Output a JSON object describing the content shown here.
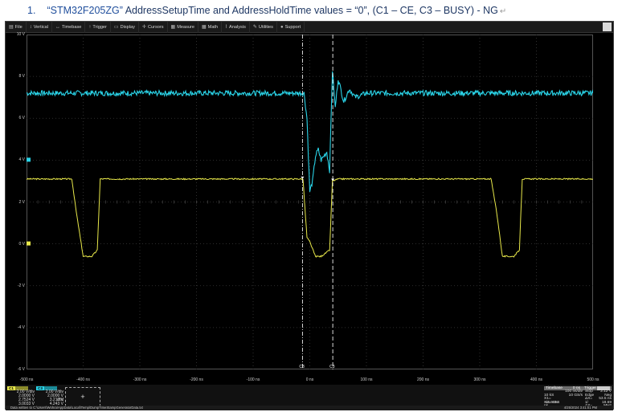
{
  "doc": {
    "number": "1.",
    "model": "“STM32F205ZG”",
    "rest": " AddressSetupTime and AddressHoldTime values = “0”, (C1 – CE, C3 – BUSY) - NG",
    "return_mark": "↵"
  },
  "menu": [
    {
      "icon": "▤",
      "label": "File",
      "name": "menu-file"
    },
    {
      "icon": "↕",
      "label": "Vertical",
      "name": "menu-vertical"
    },
    {
      "icon": "↔",
      "label": "Timebase",
      "name": "menu-timebase"
    },
    {
      "icon": "↑",
      "label": "Trigger",
      "name": "menu-trigger"
    },
    {
      "icon": "▭",
      "label": "Display",
      "name": "menu-display"
    },
    {
      "icon": "✛",
      "label": "Cursors",
      "name": "menu-cursors"
    },
    {
      "icon": "▦",
      "label": "Measure",
      "name": "menu-measure"
    },
    {
      "icon": "▦",
      "label": "Math",
      "name": "menu-math"
    },
    {
      "icon": "⌇",
      "label": "Analysis",
      "name": "menu-analysis"
    },
    {
      "icon": "✎",
      "label": "Utilities",
      "name": "menu-utilities"
    },
    {
      "icon": "●",
      "label": "Support",
      "name": "menu-support"
    }
  ],
  "brand_badge": "Teledyne LeCroy",
  "y_labels": [
    "10 V",
    "8 V",
    "6 V",
    "4 V",
    "2 V",
    "0 V",
    "-2 V",
    "-4 V",
    "-6 V"
  ],
  "x_labels": [
    "-500 ns",
    "-400 ns",
    "-300 ns",
    "-200 ns",
    "-100 ns",
    "0 ns",
    "100 ns",
    "200 ns",
    "300 ns",
    "400 ns",
    "500 ns"
  ],
  "cursor_labels": [
    "C3",
    "C3"
  ],
  "colors": {
    "c1": "#e8e84a",
    "c3": "#2ad4e8",
    "grid": "#3a3a3a"
  },
  "chart_data": {
    "type": "line",
    "x_unit": "ns",
    "y_unit": "V",
    "xlim": [
      -500,
      500
    ],
    "ylim": [
      -6,
      10
    ],
    "grid": true,
    "series": [
      {
        "name": "C1",
        "x": [
          -500,
          -450,
          -420,
          -412,
          -400,
          -385,
          -375,
          -370,
          -350,
          -20,
          -12,
          -5,
          0,
          10,
          20,
          35,
          40,
          50,
          100,
          300,
          320,
          330,
          340,
          360,
          370,
          375,
          390,
          500
        ],
        "y": [
          3.1,
          3.1,
          3.1,
          1.5,
          -0.6,
          -0.6,
          -0.3,
          3.1,
          3.1,
          3.1,
          3.1,
          0.3,
          0.1,
          -0.6,
          -0.6,
          -0.3,
          3.0,
          3.1,
          3.1,
          3.1,
          3.1,
          1.5,
          -0.6,
          -0.6,
          -0.3,
          3.1,
          3.1,
          3.1
        ]
      },
      {
        "name": "C3",
        "x": [
          -500,
          -20,
          -10,
          -5,
          0,
          5,
          10,
          15,
          20,
          30,
          35,
          40,
          45,
          50,
          60,
          70,
          80,
          100,
          500
        ],
        "y": [
          7.2,
          7.2,
          7.2,
          6.0,
          2.5,
          3.0,
          4.2,
          4.5,
          4.0,
          4.4,
          3.5,
          8.3,
          6.5,
          7.9,
          6.8,
          7.4,
          7.0,
          7.2,
          7.2
        ]
      }
    ],
    "cursors_x": [
      -12.9,
      40.6
    ]
  },
  "ch_table": {
    "headers": [
      "C1",
      "C3"
    ],
    "labels": [
      "",
      "",
      "",
      "",
      "Δy"
    ],
    "rows_c1": [
      "2.00 V/div",
      "2.0000 V",
      "2.7524 V",
      "3.0033 V",
      "250.9 mV"
    ],
    "rows_c3": [
      "2.00 V/div",
      "2.0000 V ofst",
      "3.212 V",
      "4.243 V",
      "1.032 V"
    ],
    "empty_slot": "+"
  },
  "timebase": {
    "hdr_left": "Timebase",
    "hdr_mid": "0 ns",
    "hdr_right": "Trigger",
    "rows": [
      [
        "",
        "100 ns/div",
        "Stop",
        "2.12 V"
      ],
      [
        "10 kS",
        "10 GS/s",
        "Edge",
        "Neg"
      ],
      [
        "X1= -12.9 ns",
        "",
        "ΔX=",
        "53.5 ns"
      ],
      [
        "X2= 40.6 ns",
        "",
        "1/ΔX=",
        "18.69 MHz"
      ]
    ]
  },
  "status": {
    "message": "Data written to C:\\Users\\Wohra\\AppData\\Local\\Temp\\DumpTimeStampGeneratorData.txt",
    "time": "4/25/2024 3:41:01 PM"
  }
}
